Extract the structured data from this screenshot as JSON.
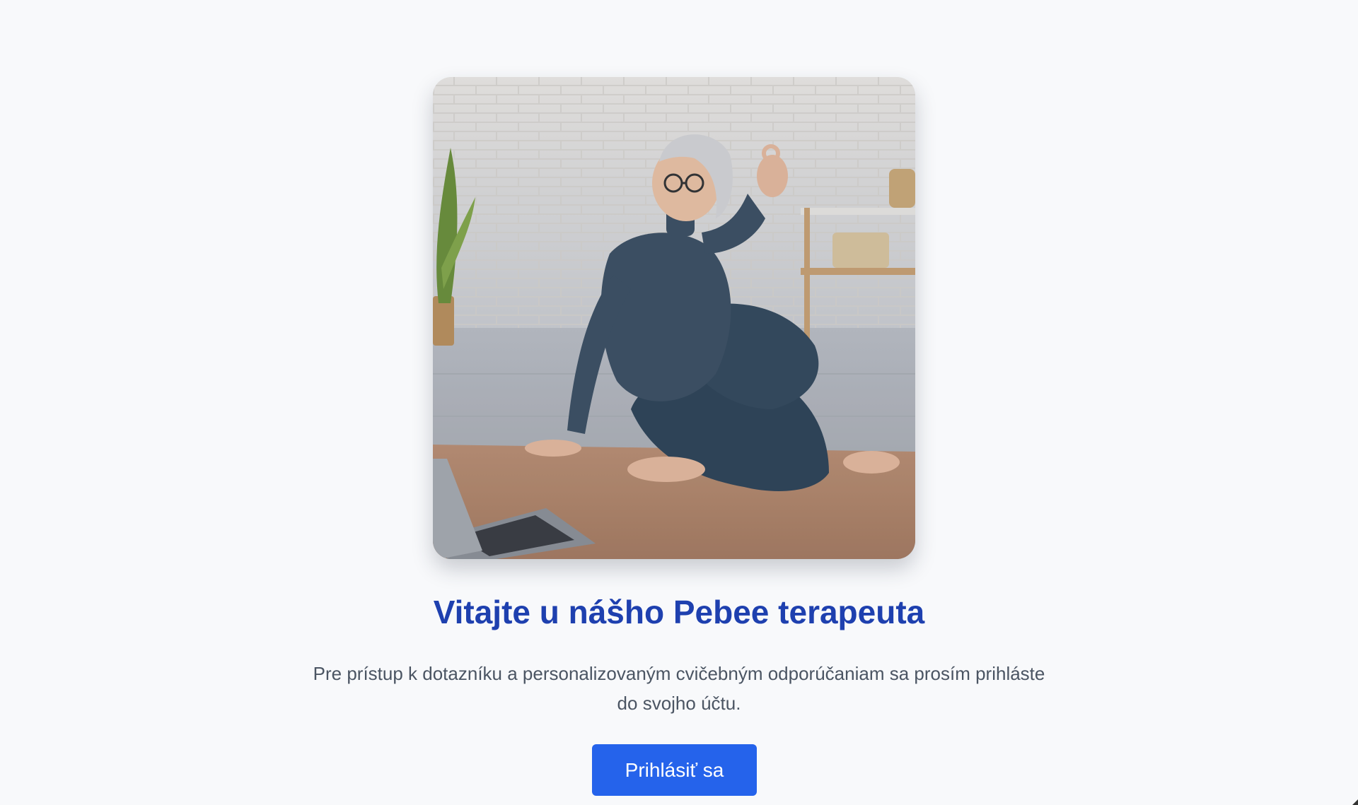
{
  "hero": {
    "image_description_icon": "yoga-illustration"
  },
  "welcome": {
    "title": "Vitajte u nášho Pebee terapeuta",
    "description": "Pre prístup k dotazníku a personalizovaným cvičebným odporúčaniam sa prosím prihláste do svojho účtu."
  },
  "actions": {
    "login_label": "Prihlásiť sa"
  },
  "colors": {
    "background": "#f8f9fb",
    "title": "#1e40af",
    "text": "#4b5563",
    "button": "#2563eb"
  }
}
